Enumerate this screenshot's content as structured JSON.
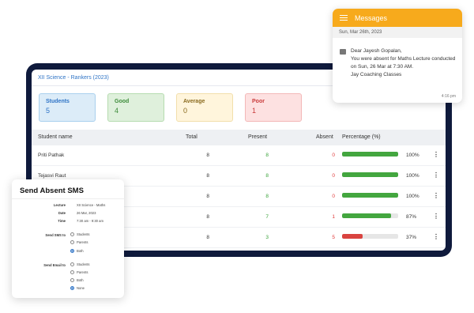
{
  "dashboard": {
    "title": "XII Science - Rankers (2023)",
    "stats": [
      {
        "label": "Students",
        "value": "5"
      },
      {
        "label": "Good",
        "value": "4"
      },
      {
        "label": "Average",
        "value": "0"
      },
      {
        "label": "Poor",
        "value": "1"
      }
    ],
    "columns": [
      "Student name",
      "Total",
      "Present",
      "Absent",
      "Percentage (%)"
    ],
    "rows": [
      {
        "name": "Priti Pathak",
        "total": "8",
        "present": "8",
        "absent": "0",
        "percent": "100%",
        "fraction": 1.0
      },
      {
        "name": "Tejasvi Raut",
        "total": "8",
        "present": "8",
        "absent": "0",
        "percent": "100%",
        "fraction": 1.0
      },
      {
        "name": "",
        "total": "8",
        "present": "8",
        "absent": "0",
        "percent": "100%",
        "fraction": 1.0
      },
      {
        "name": "",
        "total": "8",
        "present": "7",
        "absent": "1",
        "percent": "87%",
        "fraction": 0.87
      },
      {
        "name": "",
        "total": "8",
        "present": "3",
        "absent": "5",
        "percent": "37%",
        "fraction": 0.37
      }
    ]
  },
  "messages": {
    "title": "Messages",
    "date": "Sun, Mar 26th, 2023",
    "text": "Dear Jayesh Gopalan,\nYou were absent for Maths Lecture conducted on Sun, 26 Mar at  7:30 AM.\nJay Coaching Classes",
    "time": "4:16 pm"
  },
  "sms": {
    "title": "Send Absent SMS",
    "details": [
      {
        "key": "Lecture",
        "value": "XII Science - Maths"
      },
      {
        "key": "Date",
        "value": "26 Mar, 2023"
      },
      {
        "key": "Time",
        "value": "7:30 am - 9:30 am"
      }
    ],
    "send_sms_label": "Send SMS to",
    "send_sms_options": [
      "Students",
      "Parents",
      "Both"
    ],
    "send_sms_selected": "Both",
    "send_email_label": "Send Email to",
    "send_email_options": [
      "Students",
      "Parents",
      "Both",
      "None"
    ],
    "send_email_selected": "None"
  }
}
